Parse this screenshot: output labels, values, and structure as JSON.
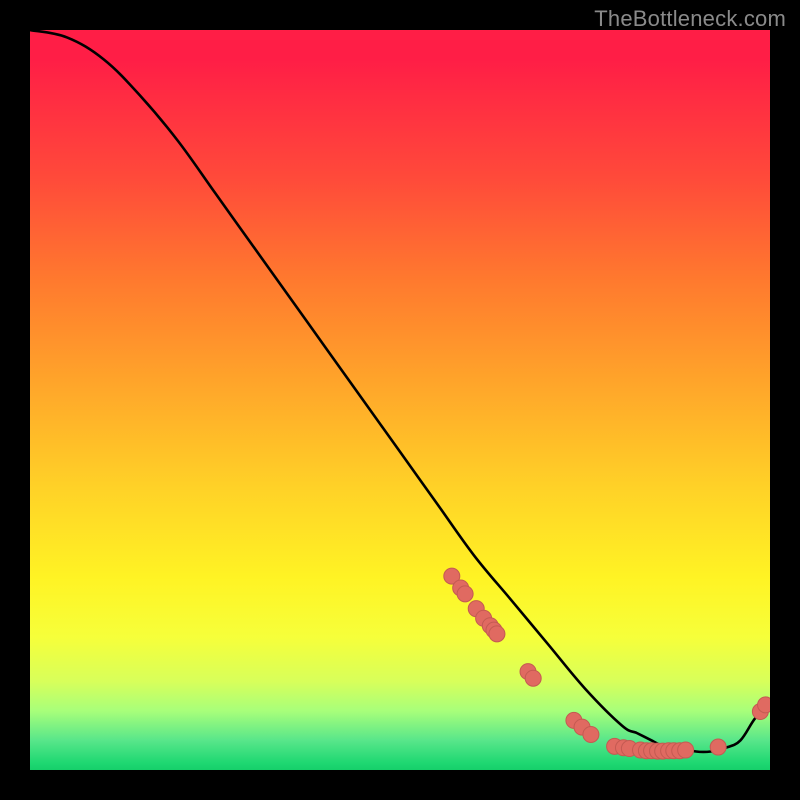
{
  "watermark": {
    "text": "TheBottleneck.com"
  },
  "colors": {
    "curve_stroke": "#000000",
    "marker_fill": "#e06a61",
    "marker_stroke": "#c45a52",
    "gradient_top": "#ff1e46",
    "gradient_mid": "#ffd227",
    "gradient_bottom": "#16cf6a",
    "page_bg": "#000000"
  },
  "chart_data": {
    "type": "line",
    "title": "",
    "xlabel": "",
    "ylabel": "",
    "xlim": [
      0,
      100
    ],
    "ylim": [
      0,
      100
    ],
    "grid": false,
    "legend": false,
    "series": [
      {
        "name": "curve",
        "x": [
          0,
          5,
          10,
          15,
          20,
          25,
          30,
          35,
          40,
          45,
          50,
          55,
          60,
          65,
          70,
          75,
          80,
          82,
          84,
          86,
          88,
          90,
          92,
          94,
          96,
          98,
          100
        ],
        "y": [
          100,
          99,
          96,
          91,
          85,
          78,
          71,
          64,
          57,
          50,
          43,
          36,
          29,
          23,
          17,
          11,
          6,
          5,
          4,
          3,
          3,
          2.5,
          2.5,
          3,
          4,
          7,
          9
        ]
      }
    ],
    "markers": [
      {
        "x": 57,
        "y": 26.2
      },
      {
        "x": 58.2,
        "y": 24.6
      },
      {
        "x": 58.8,
        "y": 23.8
      },
      {
        "x": 60.3,
        "y": 21.8
      },
      {
        "x": 61.3,
        "y": 20.5
      },
      {
        "x": 62.2,
        "y": 19.5
      },
      {
        "x": 62.7,
        "y": 18.9
      },
      {
        "x": 63.1,
        "y": 18.4
      },
      {
        "x": 67.3,
        "y": 13.3
      },
      {
        "x": 68.0,
        "y": 12.4
      },
      {
        "x": 73.5,
        "y": 6.7
      },
      {
        "x": 74.6,
        "y": 5.8
      },
      {
        "x": 75.8,
        "y": 4.8
      },
      {
        "x": 79.0,
        "y": 3.2
      },
      {
        "x": 80.2,
        "y": 3.0
      },
      {
        "x": 81.0,
        "y": 2.9
      },
      {
        "x": 82.5,
        "y": 2.7
      },
      {
        "x": 83.3,
        "y": 2.6
      },
      {
        "x": 84.0,
        "y": 2.6
      },
      {
        "x": 84.8,
        "y": 2.55
      },
      {
        "x": 85.5,
        "y": 2.55
      },
      {
        "x": 86.3,
        "y": 2.6
      },
      {
        "x": 87.0,
        "y": 2.6
      },
      {
        "x": 87.8,
        "y": 2.6
      },
      {
        "x": 88.6,
        "y": 2.7
      },
      {
        "x": 93.0,
        "y": 3.1
      },
      {
        "x": 98.7,
        "y": 7.9
      },
      {
        "x": 99.4,
        "y": 8.8
      }
    ]
  }
}
